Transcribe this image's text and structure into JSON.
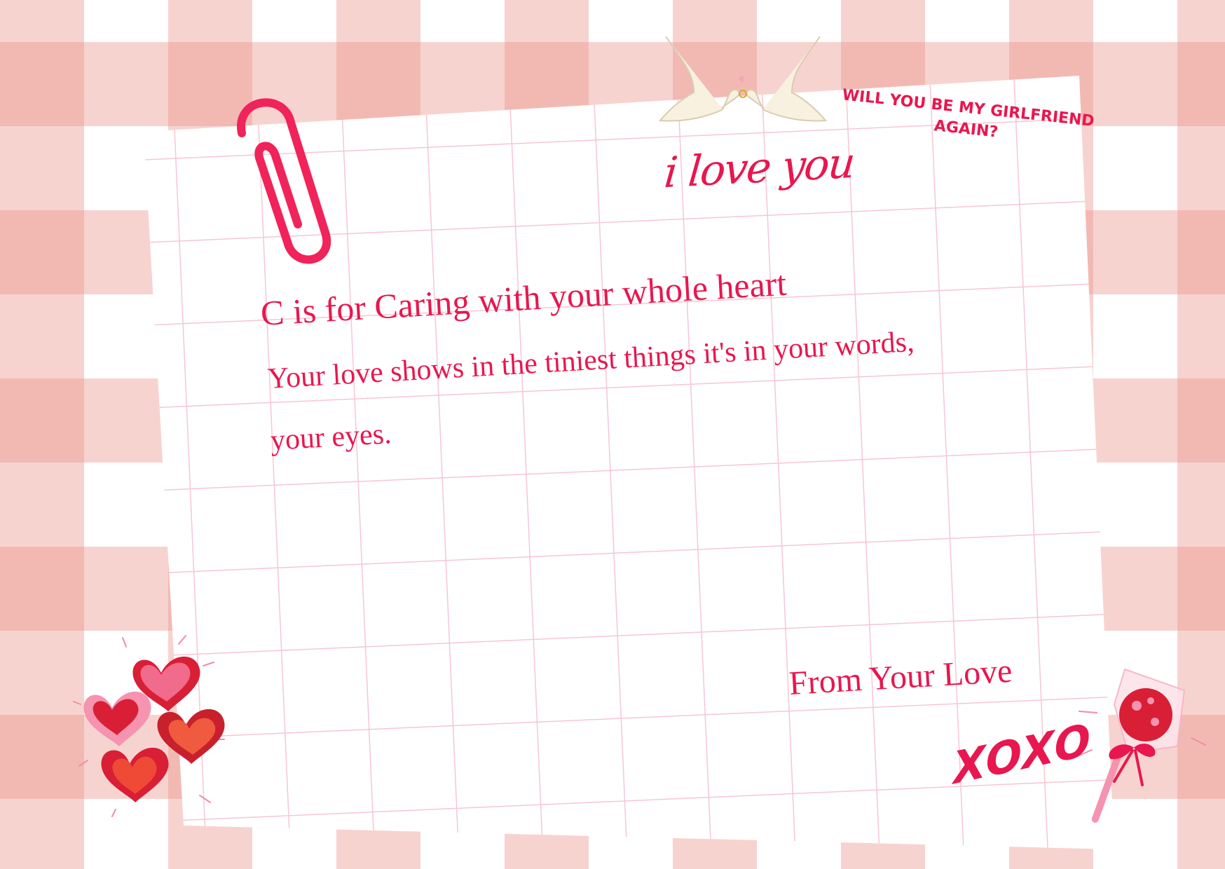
{
  "letter": {
    "heading": "C is for Caring with your whole heart",
    "body_line1": "Your love shows in the tiniest things it's in your words,",
    "body_line2": "your eyes.",
    "signature": "From Your Love",
    "love_note": "i love you",
    "question": "WILL YOU BE MY GIRLFRIEND AGAIN?",
    "xoxo": "XOXO"
  },
  "icons": [
    "paperclip-icon",
    "doves-icon",
    "candy-hearts-icon",
    "lollipop-icon"
  ],
  "colors": {
    "accent": "#e8174f",
    "gingham": "#ec968c",
    "paper": "#ffffff",
    "grid": "#f7c6d2"
  }
}
